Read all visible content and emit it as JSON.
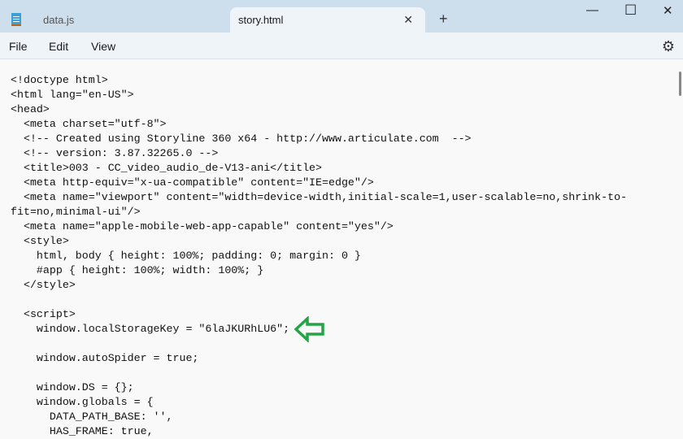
{
  "tabs": [
    {
      "label": "data.js"
    },
    {
      "label": "story.html",
      "close": "✕"
    }
  ],
  "new_tab": "+",
  "window_controls": {
    "minimize": "—",
    "maximize": "☐",
    "close": "✕"
  },
  "menu": [
    "File",
    "Edit",
    "View"
  ],
  "settings_icon": "⚙",
  "lines": [
    "<!doctype html>",
    "<html lang=\"en-US\">",
    "<head>",
    "  <meta charset=\"utf-8\">",
    "  <!-- Created using Storyline 360 x64 - http://www.articulate.com  -->",
    "  <!-- version: 3.87.32265.0 -->",
    "  <title>003 - CC_video_audio_de-V13-ani</title>",
    "  <meta http-equiv=\"x-ua-compatible\" content=\"IE=edge\"/>",
    "  <meta name=\"viewport\" content=\"width=device-width,initial-scale=1,user-scalable=no,shrink-to-",
    "fit=no,minimal-ui\"/>",
    "  <meta name=\"apple-mobile-web-app-capable\" content=\"yes\"/>",
    "  <style>",
    "    html, body { height: 100%; padding: 0; margin: 0 }",
    "    #app { height: 100%; width: 100%; }",
    "  </style>",
    "",
    "  <script>",
    "    window.localStorageKey = \"6laJKURhLU6\";",
    "",
    "    window.autoSpider = true;",
    "",
    "    window.DS = {};",
    "    window.globals = {",
    "      DATA_PATH_BASE: '',",
    "      HAS_FRAME: true,"
  ],
  "annotation_color": "#22a447"
}
